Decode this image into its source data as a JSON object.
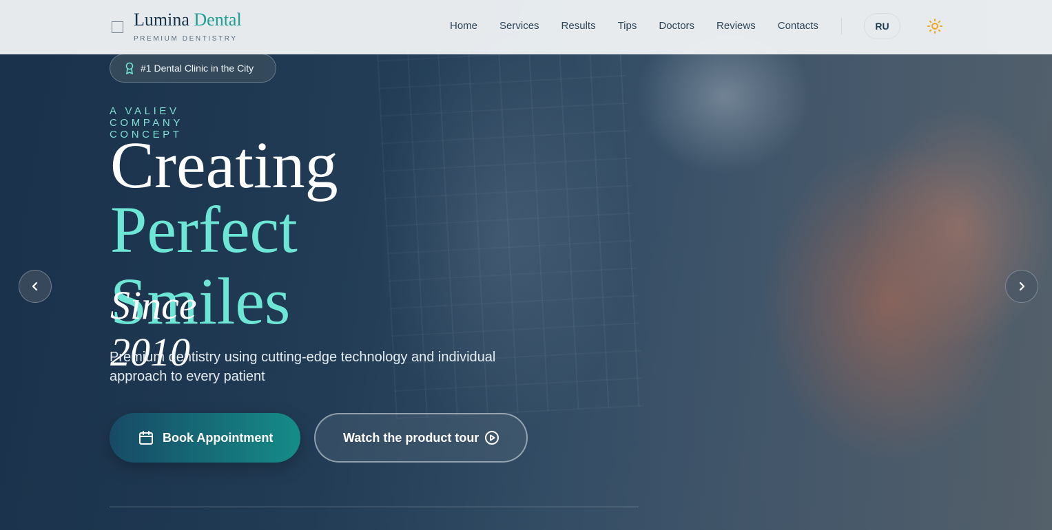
{
  "header": {
    "brand_name_main": "Lumina",
    "brand_name_accent": "Dental",
    "brand_tagline": "PREMIUM DENTISTRY",
    "nav": [
      "Home",
      "Services",
      "Results",
      "Tips",
      "Doctors",
      "Reviews",
      "Contacts"
    ],
    "language": "RU",
    "theme_icon": "sun-icon"
  },
  "hero": {
    "badge": "#1 Dental Clinic in the City",
    "badge_icon": "award-icon",
    "concept": "A VALIEV COMPANY CONCEPT",
    "title_line1": "Creating",
    "title_line2": "Perfect Smiles",
    "since": "Since 2010",
    "description": "Premium dentistry using cutting-edge technology and individual approach to every patient",
    "primary_button": "Book Appointment",
    "primary_icon": "calendar-icon",
    "secondary_button": "Watch the product tour",
    "secondary_icon": "play-circle-icon"
  },
  "colors": {
    "accent": "#1d9e94",
    "headline_accent": "#6ee6d6",
    "navy": "#15324a"
  }
}
